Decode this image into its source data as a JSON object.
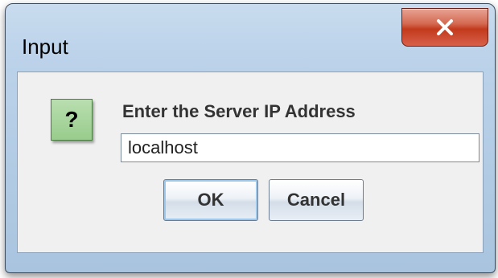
{
  "window": {
    "title": "Input"
  },
  "titlebar": {
    "close_icon": "close-icon"
  },
  "dialog": {
    "icon": "question-icon",
    "icon_glyph": "?",
    "prompt": "Enter the Server IP Address",
    "input_value": "localhost"
  },
  "buttons": {
    "ok_label": "OK",
    "cancel_label": "Cancel"
  },
  "colors": {
    "titlebar": "#bcd3ea",
    "close_button": "#c33a1c",
    "icon_background": "#98cc8c",
    "content_background": "#f0f0f0"
  }
}
